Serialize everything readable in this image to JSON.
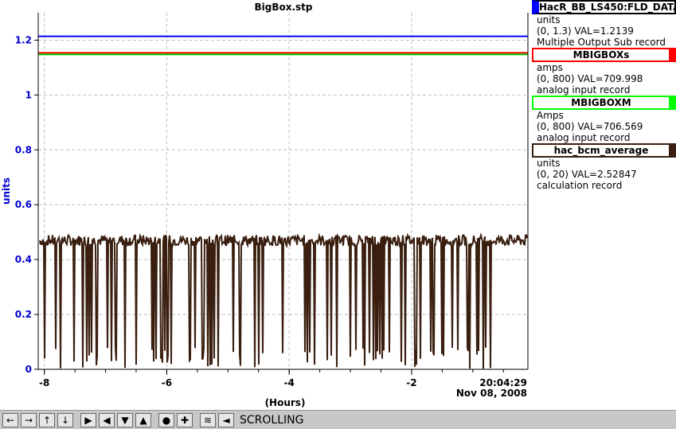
{
  "chart_data": {
    "type": "line",
    "title": "BigBox.stp",
    "ylabel": "units",
    "xlabel": "(Hours)",
    "ylim": [
      0,
      1.3
    ],
    "xlim": [
      -8.1,
      -0.1
    ],
    "yticks": [
      "0",
      "0.2",
      "0.4",
      "0.6",
      "0.8",
      "1",
      "1.2"
    ],
    "xticks": [
      "-8",
      "-6",
      "-4",
      "-2"
    ],
    "x_end_time": "20:04:29",
    "x_end_date": "Nov 08, 2008",
    "grid": true,
    "series": [
      {
        "name": "HacR_BB_LS450:FLD_DATA",
        "color": "#0000ff",
        "type": "constant",
        "value": 1.2139,
        "scale_max": 1.3
      },
      {
        "name": "MBIGBOXs",
        "color": "#ff0000",
        "type": "constant",
        "value": 709.998,
        "scale_max": 800
      },
      {
        "name": "MBIGBOXM",
        "color": "#00cc00",
        "type": "constant",
        "value": 706.569,
        "scale_max": 800
      },
      {
        "name": "hac_bcm_average",
        "color": "#3a1f10",
        "type": "noisy",
        "baseline": 0.47,
        "scale_max": 20
      }
    ]
  },
  "legend": [
    {
      "name": "HacR_BB_LS450:FLD_DATA",
      "color": "#0000ff",
      "units": "units",
      "range_val": "(0, 1.3) VAL=1.2139",
      "record": "Multiple Output Sub record"
    },
    {
      "name": "MBIGBOXs",
      "color": "#ff0000",
      "units": "amps",
      "range_val": "(0, 800) VAL=709.998",
      "record": "analog input record"
    },
    {
      "name": "MBIGBOXM",
      "color": "#00ff00",
      "units": "Amps",
      "range_val": "(0, 800) VAL=706.569",
      "record": "analog input record"
    },
    {
      "name": "hac_bcm_average",
      "color": "#3a1f10",
      "units": "units",
      "range_val": "(0, 20) VAL=2.52847",
      "record": "calculation record"
    }
  ],
  "toolbar": {
    "buttons": [
      "pan-left-icon",
      "pan-right-icon",
      "pan-up-icon",
      "pan-down-icon",
      "zoom-in-x-icon",
      "zoom-out-x-icon",
      "zoom-in-y-icon",
      "zoom-out-y-icon",
      "zoom-reset-icon",
      "zoom-in-icon",
      "scroll-mode-icon",
      "back-icon"
    ],
    "mode_label": "SCROLLING"
  }
}
